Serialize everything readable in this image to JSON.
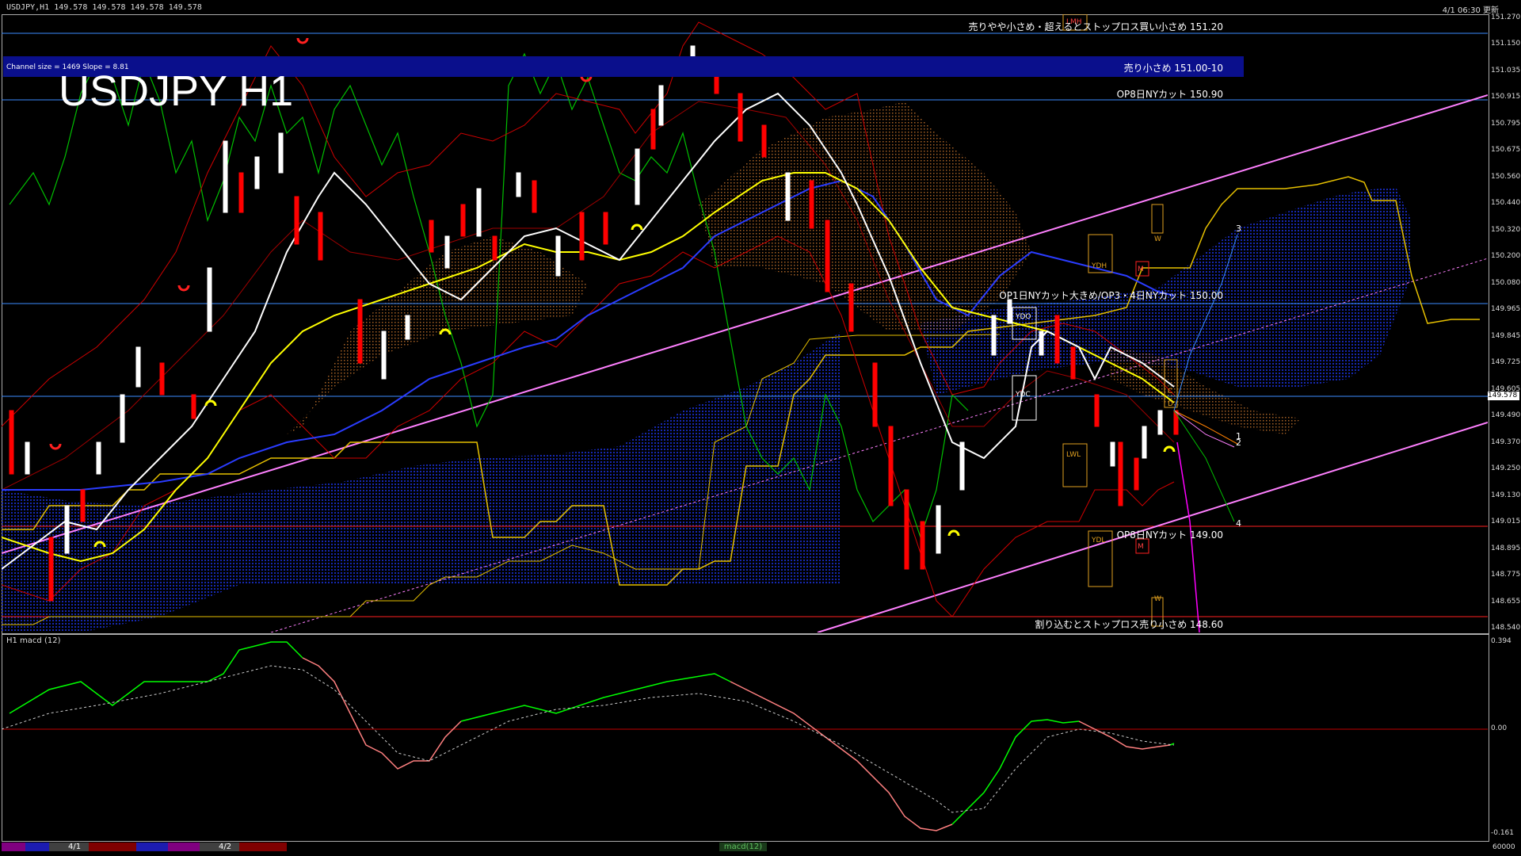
{
  "header": {
    "symbol_info": "USDJPY,H1  149.578 149.578 149.578 149.578",
    "updated": "4/1 06:30 更新"
  },
  "chart_title": "USDJPY H1",
  "channel_info": "Channel size = 1469 Slope = 8.81",
  "levels": {
    "l1": "売りやや小さめ・超えるとストップロス買い小さめ 151.20",
    "l2": "売り小さめ 151.00-10",
    "l3": "OP8日NYカット 150.90",
    "l4": "OP1日NYカット大きめ/OP3・4日NYカット 150.00",
    "l5": "OP8日NYカット 149.00",
    "l6": "割り込むとストップロス売り小さめ 148.60"
  },
  "box_labels": {
    "lmh": "LMH",
    "lwl": "LWL",
    "ydh": "YDH",
    "ydo": "YDO",
    "ydc": "YDC",
    "ydl": "YDL",
    "lwl2": "LWL",
    "w1": "W",
    "w2": "W",
    "m1": "M",
    "m2": "M",
    "c": "C",
    "d": "D"
  },
  "wave_labels": {
    "n1": "1",
    "n2": "2",
    "n3": "3",
    "n4": "4"
  },
  "yaxis_ticks": [
    "151.270",
    "151.150",
    "151.035",
    "150.915",
    "150.795",
    "150.675",
    "150.560",
    "150.440",
    "150.320",
    "150.200",
    "150.080",
    "149.965",
    "149.845",
    "149.725",
    "149.605",
    "149.490",
    "149.370",
    "149.250",
    "149.130",
    "149.015",
    "148.895",
    "148.775",
    "148.655",
    "148.540"
  ],
  "current_price": "149.578",
  "macd": {
    "title": "H1  macd (12)",
    "ticks": [
      "0.394",
      "0.00",
      "-0.161"
    ]
  },
  "bottom_bar": {
    "date1": "4/1",
    "date2": "4/2",
    "scroll_label": "macd(12)",
    "right_value": "60000"
  },
  "colors": {
    "background": "#000000",
    "bull_candle": "#ffffff",
    "bear_candle": "#ff0000",
    "ma_white": "#ffffff",
    "ma_yellow": "#ffff00",
    "ma_blue": "#2a3cff",
    "bollinger": "#ff0000",
    "chikou": "#00c000",
    "kumo_line": "#e6c000",
    "channel_line": "#ff80ff",
    "level_line": "#3b8cff",
    "support_line": "#ff2020",
    "macd_up": "#00ff00",
    "macd_down": "#ff8080",
    "channel_bar": "#0a0f8c"
  }
}
